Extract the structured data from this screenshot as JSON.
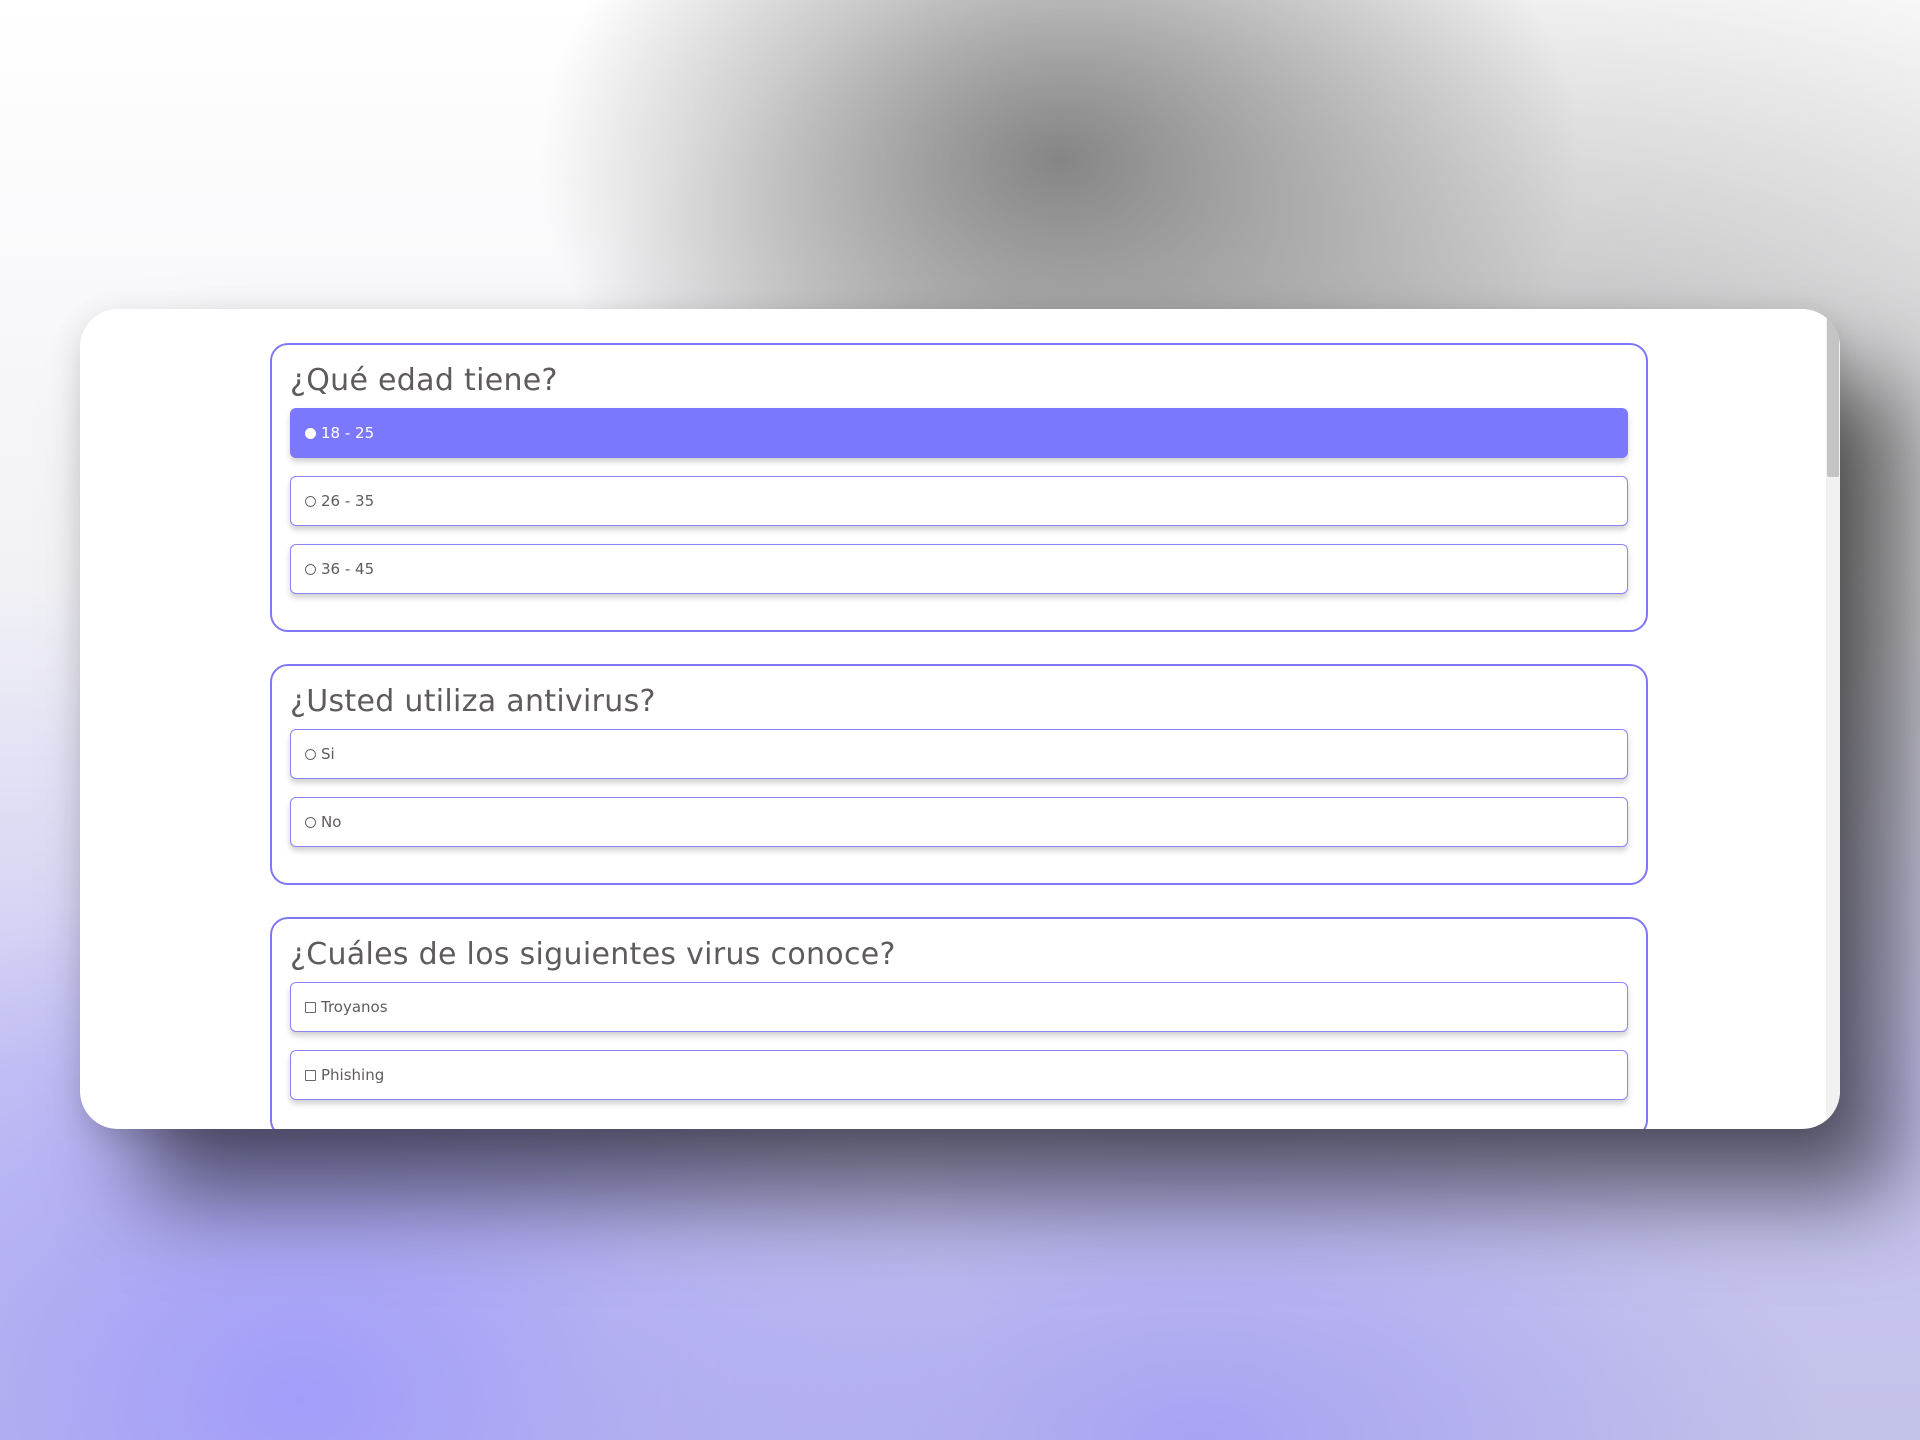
{
  "questions": [
    {
      "title": "¿Qué edad tiene?",
      "type": "radio",
      "options": [
        {
          "label": "18 - 25",
          "selected": true
        },
        {
          "label": "26 - 35",
          "selected": false
        },
        {
          "label": "36 - 45",
          "selected": false
        }
      ]
    },
    {
      "title": "¿Usted utiliza antivirus?",
      "type": "radio",
      "options": [
        {
          "label": "Si",
          "selected": false
        },
        {
          "label": "No",
          "selected": false
        }
      ]
    },
    {
      "title": "¿Cuáles de los siguientes virus conoce?",
      "type": "checkbox",
      "options": [
        {
          "label": "Troyanos",
          "selected": false
        },
        {
          "label": "Phishing",
          "selected": false
        }
      ]
    }
  ],
  "colors": {
    "accent": "#7c78fd",
    "border": "#7f77f8",
    "text": "#5f5b5b"
  }
}
